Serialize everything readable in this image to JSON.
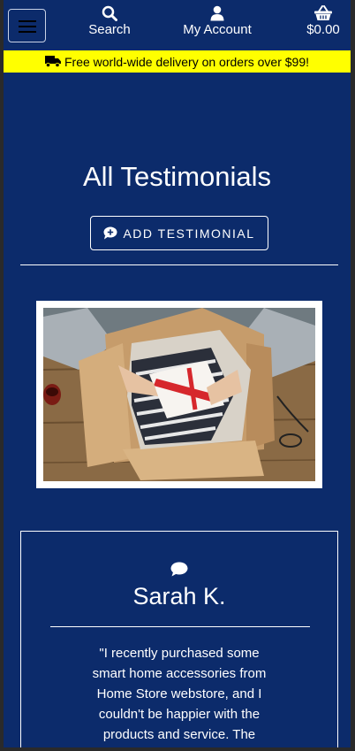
{
  "nav": {
    "search_label": "Search",
    "account_label": "My Account",
    "cart_label": "$0.00"
  },
  "banner": {
    "text": "Free world-wide delivery on orders over $99!"
  },
  "page": {
    "title": "All Testimonials",
    "add_button_label": "ADD TESTIMONIAL"
  },
  "testimonial": {
    "author": "Sarah K.",
    "text": "\"I recently purchased some smart home accessories from Home Store webstore, and I couldn't be happier with the products and service. The"
  },
  "colors": {
    "background": "#0c2b6b",
    "banner": "#ffff00",
    "text": "#ffffff"
  },
  "icons": {
    "menu": "hamburger-icon",
    "search": "search-icon",
    "account": "user-icon",
    "cart": "basket-icon",
    "delivery": "truck-icon",
    "add": "comment-plus-icon",
    "testimonial": "comment-icon"
  }
}
